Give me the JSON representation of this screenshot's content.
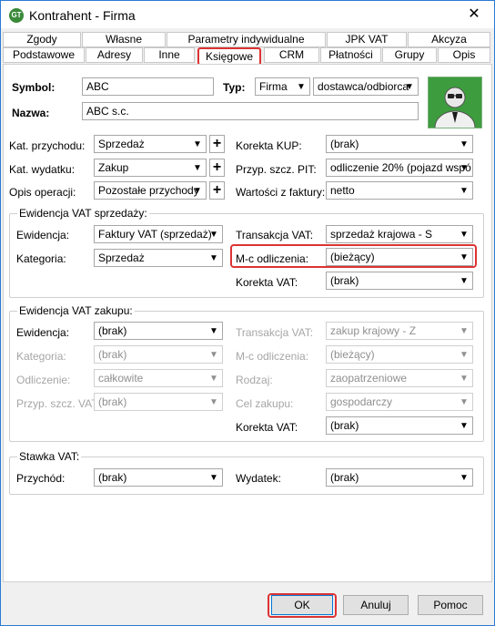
{
  "window": {
    "title": "Kontrahent - Firma",
    "close": "✕",
    "icon_name": "app-icon"
  },
  "tabs_row1": [
    "Zgody",
    "Własne",
    "Parametry indywidualne",
    "JPK VAT",
    "Akcyza"
  ],
  "tabs_row2": [
    "Podstawowe",
    "Adresy",
    "Inne",
    "Księgowe",
    "CRM",
    "Płatności",
    "Grupy",
    "Opis"
  ],
  "active_tab": "Księgowe",
  "header": {
    "symbol_label": "Symbol:",
    "symbol_value": "ABC",
    "typ_label": "Typ:",
    "typ_value": "Firma",
    "typ_value2": "dostawca/odbiorca",
    "nazwa_label": "Nazwa:",
    "nazwa_value": "ABC s.c."
  },
  "general": {
    "kat_przychodu_label": "Kat. przychodu:",
    "kat_przychodu_value": "Sprzedaż",
    "kat_wydatku_label": "Kat. wydatku:",
    "kat_wydatku_value": "Zakup",
    "opis_operacji_label": "Opis operacji:",
    "opis_operacji_value": "Pozostałe przychody",
    "korekta_kup_label": "Korekta KUP:",
    "korekta_kup_value": "(brak)",
    "przyp_pit_label": "Przyp. szcz. PIT:",
    "przyp_pit_value": "odliczenie 20% (pojazd wspó",
    "wartosci_label": "Wartości z faktury:",
    "wartosci_value": "netto"
  },
  "vat_sprzedazy": {
    "title": "Ewidencja VAT sprzedaży:",
    "ewidencja_label": "Ewidencja:",
    "ewidencja_value": "Faktury VAT (sprzedaż)",
    "kategoria_label": "Kategoria:",
    "kategoria_value": "Sprzedaż",
    "transakcja_label": "Transakcja VAT:",
    "transakcja_value": "sprzedaż krajowa - S",
    "mc_label": "M-c odliczenia:",
    "mc_value": "(bieżący)",
    "korekta_label": "Korekta VAT:",
    "korekta_value": "(brak)"
  },
  "vat_zakupu": {
    "title": "Ewidencja VAT zakupu:",
    "ewidencja_label": "Ewidencja:",
    "ewidencja_value": "(brak)",
    "kategoria_label": "Kategoria:",
    "kategoria_value": "(brak)",
    "odliczenie_label": "Odliczenie:",
    "odliczenie_value": "całkowite",
    "przyp_vat_label": "Przyp. szcz. VAT:",
    "przyp_vat_value": "(brak)",
    "transakcja_label": "Transakcja VAT:",
    "transakcja_value": "zakup krajowy - Z",
    "mc_label": "M-c odliczenia:",
    "mc_value": "(bieżący)",
    "rodzaj_label": "Rodzaj:",
    "rodzaj_value": "zaopatrzeniowe",
    "cel_label": "Cel zakupu:",
    "cel_value": "gospodarczy",
    "korekta_label": "Korekta VAT:",
    "korekta_value": "(brak)"
  },
  "stawka_vat": {
    "title": "Stawka VAT:",
    "przychod_label": "Przychód:",
    "przychod_value": "(brak)",
    "wydatek_label": "Wydatek:",
    "wydatek_value": "(brak)"
  },
  "buttons": {
    "ok": "OK",
    "cancel": "Anuluj",
    "help": "Pomoc"
  },
  "colors": {
    "highlight": "#dd3333",
    "avatar_bg": "#3d9c3d"
  }
}
